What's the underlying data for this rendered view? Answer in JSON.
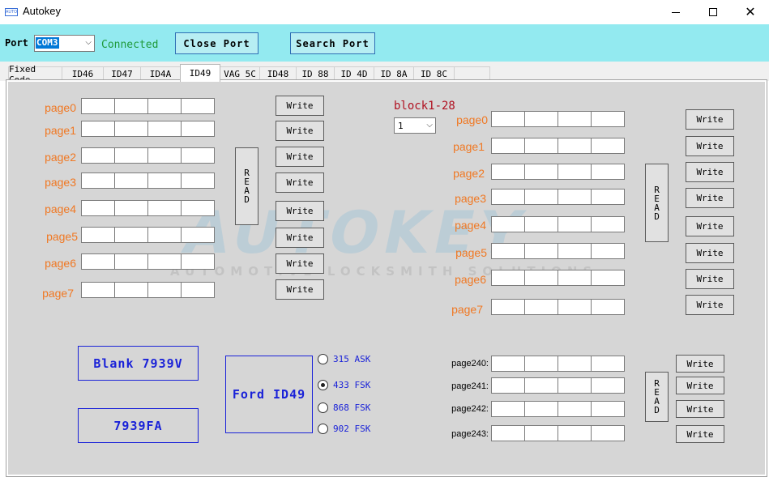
{
  "window": {
    "title": "Autokey",
    "icon_text": "AUTOKEY",
    "controls": {
      "minimize": "minimize-icon",
      "maximize": "maximize-icon",
      "close": "close-icon"
    }
  },
  "toolbar": {
    "port_label": "Port",
    "port_value": "COM3",
    "status": "Connected",
    "close_port": "Close Port",
    "search_port": "Search Port"
  },
  "tabs": [
    {
      "label": "Fixed Code",
      "active": false
    },
    {
      "label": "ID46",
      "active": false
    },
    {
      "label": "ID47",
      "active": false
    },
    {
      "label": "ID4A",
      "active": false
    },
    {
      "label": "ID49",
      "active": true
    },
    {
      "label": "VAG 5C",
      "active": false
    },
    {
      "label": "ID48",
      "active": false
    },
    {
      "label": "ID 88",
      "active": false
    },
    {
      "label": "ID 4D",
      "active": false
    },
    {
      "label": "ID 8A",
      "active": false
    },
    {
      "label": "ID 8C",
      "active": false
    }
  ],
  "watermark": {
    "brand": "AUTOKEY",
    "tagline": "AUTOMOTIVE LOCKSMITH SOLUTIONS"
  },
  "left_pages": {
    "labels": [
      "page0",
      "page1",
      "page2",
      "page3",
      "page4",
      "page5",
      "page6",
      "page7"
    ],
    "write_label": "Write",
    "read_label": [
      "R",
      "E",
      "A",
      "D"
    ]
  },
  "right_pages": {
    "block_label": "block1-28",
    "block_value": "1",
    "labels": [
      "page0",
      "page1",
      "page2",
      "page3",
      "page4",
      "page5",
      "page6",
      "page7"
    ],
    "write_label": "Write",
    "read_label": [
      "R",
      "E",
      "A",
      "D"
    ]
  },
  "config_pages": {
    "labels": [
      "page240:",
      "page241:",
      "page242:",
      "page243:"
    ],
    "write_label": "Write",
    "read_label": [
      "R",
      "E",
      "A",
      "D"
    ]
  },
  "actions": {
    "blank": "Blank 7939V",
    "fa": "7939FA",
    "ford": "Ford ID49"
  },
  "frequency": {
    "options": [
      "315 ASK",
      "433 FSK",
      "868 FSK",
      "902 FSK"
    ],
    "selected": "433 FSK"
  },
  "colors": {
    "toolbar_bg": "#93eaf0",
    "page_label": "#f07823",
    "status": "#1f9a3a",
    "accent_blue": "#1a22d8",
    "block_label": "#b01020"
  }
}
